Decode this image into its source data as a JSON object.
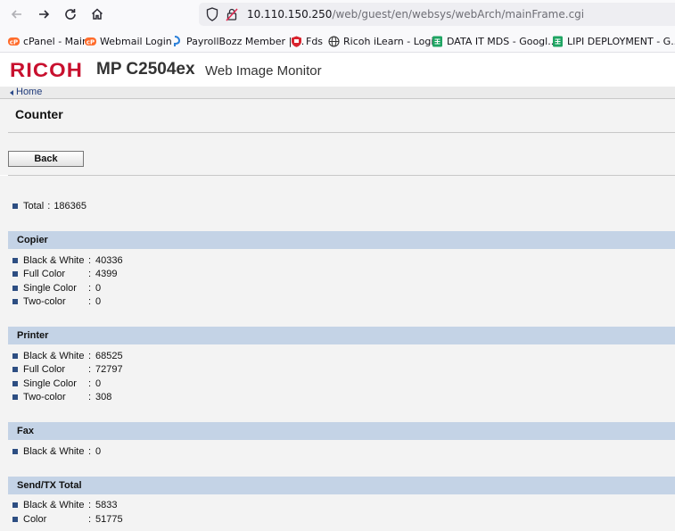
{
  "browser": {
    "url_host": "10.110.150.250",
    "url_path": "/web/guest/en/websys/webArch/mainFrame.cgi",
    "bookmarks": [
      {
        "label": "cPanel - Main",
        "icon": "cpanel-icon",
        "color": "#ff6c2c"
      },
      {
        "label": "Webmail Login",
        "icon": "cpanel-icon",
        "color": "#ff6c2c"
      },
      {
        "label": "PayrollBozz Member | ...",
        "icon": "payroll-icon",
        "color": "#2b7fd8"
      },
      {
        "label": "Fds",
        "icon": "shield-red-icon",
        "color": "#d9232e"
      },
      {
        "label": "Ricoh iLearn - Login",
        "icon": "globe-icon",
        "color": "#333333"
      },
      {
        "label": "DATA IT MDS - Googl...",
        "icon": "google-sheets-icon",
        "color": "#1fa463"
      },
      {
        "label": "LIPI DEPLOYMENT - G...",
        "icon": "google-sheets-icon",
        "color": "#1fa463"
      }
    ]
  },
  "header": {
    "logo": "RICOH",
    "model": "MP C2504ex",
    "app_name": "Web Image Monitor"
  },
  "breadcrumb": {
    "home": "Home"
  },
  "page": {
    "title": "Counter",
    "back_label": "Back",
    "total": {
      "label": "Total",
      "value": "186365"
    }
  },
  "sections": {
    "copier": {
      "title": "Copier",
      "rows": [
        {
          "label": "Black & White",
          "value": "40336"
        },
        {
          "label": "Full Color",
          "value": "4399"
        },
        {
          "label": "Single Color",
          "value": "0"
        },
        {
          "label": "Two-color",
          "value": "0"
        }
      ]
    },
    "printer": {
      "title": "Printer",
      "rows": [
        {
          "label": "Black & White",
          "value": "68525"
        },
        {
          "label": "Full Color",
          "value": "72797"
        },
        {
          "label": "Single Color",
          "value": "0"
        },
        {
          "label": "Two-color",
          "value": "308"
        }
      ]
    },
    "fax": {
      "title": "Fax",
      "rows": [
        {
          "label": "Black & White",
          "value": "0"
        }
      ]
    },
    "send_tx": {
      "title": "Send/TX Total",
      "rows": [
        {
          "label": "Black & White",
          "value": "5833"
        },
        {
          "label": "Color",
          "value": "51775"
        }
      ]
    }
  },
  "separator": ":",
  "colors": {
    "brand_red": "#c8102e",
    "section_header": "#c4d3e6",
    "bullet": "#2d4e82"
  }
}
